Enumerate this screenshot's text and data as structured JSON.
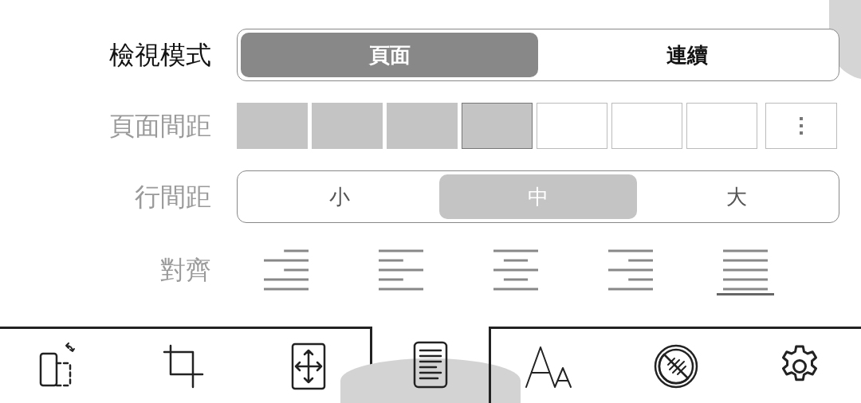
{
  "view_mode": {
    "label": "檢視模式",
    "options": [
      {
        "label": "頁面",
        "selected": true
      },
      {
        "label": "連續",
        "selected": false
      }
    ]
  },
  "page_spacing": {
    "label": "頁面間距",
    "steps": [
      {
        "filled": true,
        "selected": false
      },
      {
        "filled": true,
        "selected": false
      },
      {
        "filled": true,
        "selected": false
      },
      {
        "filled": true,
        "selected": true
      },
      {
        "filled": false,
        "selected": false
      },
      {
        "filled": false,
        "selected": false
      },
      {
        "filled": false,
        "selected": false
      }
    ]
  },
  "line_spacing": {
    "label": "行間距",
    "options": [
      {
        "label": "小",
        "selected": false
      },
      {
        "label": "中",
        "selected": true
      },
      {
        "label": "大",
        "selected": false
      }
    ]
  },
  "alignment": {
    "label": "對齊",
    "options": [
      {
        "kind": "indent",
        "selected": false
      },
      {
        "kind": "left",
        "selected": false
      },
      {
        "kind": "center",
        "selected": false
      },
      {
        "kind": "right",
        "selected": false
      },
      {
        "kind": "justify",
        "selected": true
      }
    ]
  },
  "toolbar": {
    "items": [
      {
        "kind": "rotate",
        "selected": false
      },
      {
        "kind": "crop",
        "selected": false
      },
      {
        "kind": "fit",
        "selected": false
      },
      {
        "kind": "document",
        "selected": true
      },
      {
        "kind": "font",
        "selected": false
      },
      {
        "kind": "contrast",
        "selected": false
      },
      {
        "kind": "settings",
        "selected": false
      }
    ]
  }
}
